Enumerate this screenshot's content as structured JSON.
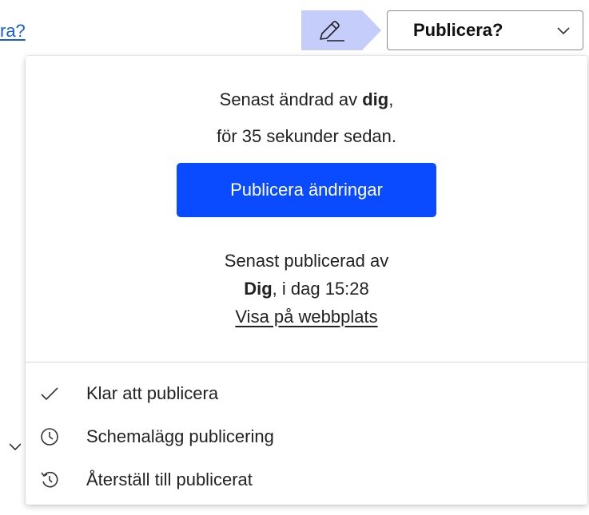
{
  "background": {
    "link_text": "ra?"
  },
  "toolbar": {
    "edit_icon": "pencil-icon",
    "publish_button_label": "Publicera?",
    "publish_chevron_icon": "chevron-down-icon"
  },
  "panel": {
    "last_changed_prefix": "Senast ändrad av ",
    "last_changed_user": "dig",
    "last_changed_suffix": ",",
    "last_changed_time": "för 35 sekunder sedan.",
    "publish_changes_label": "Publicera ändringar",
    "last_published_label": "Senast publicerad av",
    "last_published_user": "Dig",
    "last_published_time": ", i dag 15:28",
    "view_on_site_label": "Visa på webbplats",
    "menu": [
      {
        "label": "Klar att publicera",
        "icon": "checkmark-icon"
      },
      {
        "label": "Schemalägg publicering",
        "icon": "clock-icon"
      },
      {
        "label": "Återställ till publicerat",
        "icon": "history-icon"
      }
    ]
  },
  "colors": {
    "primary": "#0a4bff",
    "edit_highlight": "#c5cdfb",
    "link": "#1a5bd6"
  }
}
